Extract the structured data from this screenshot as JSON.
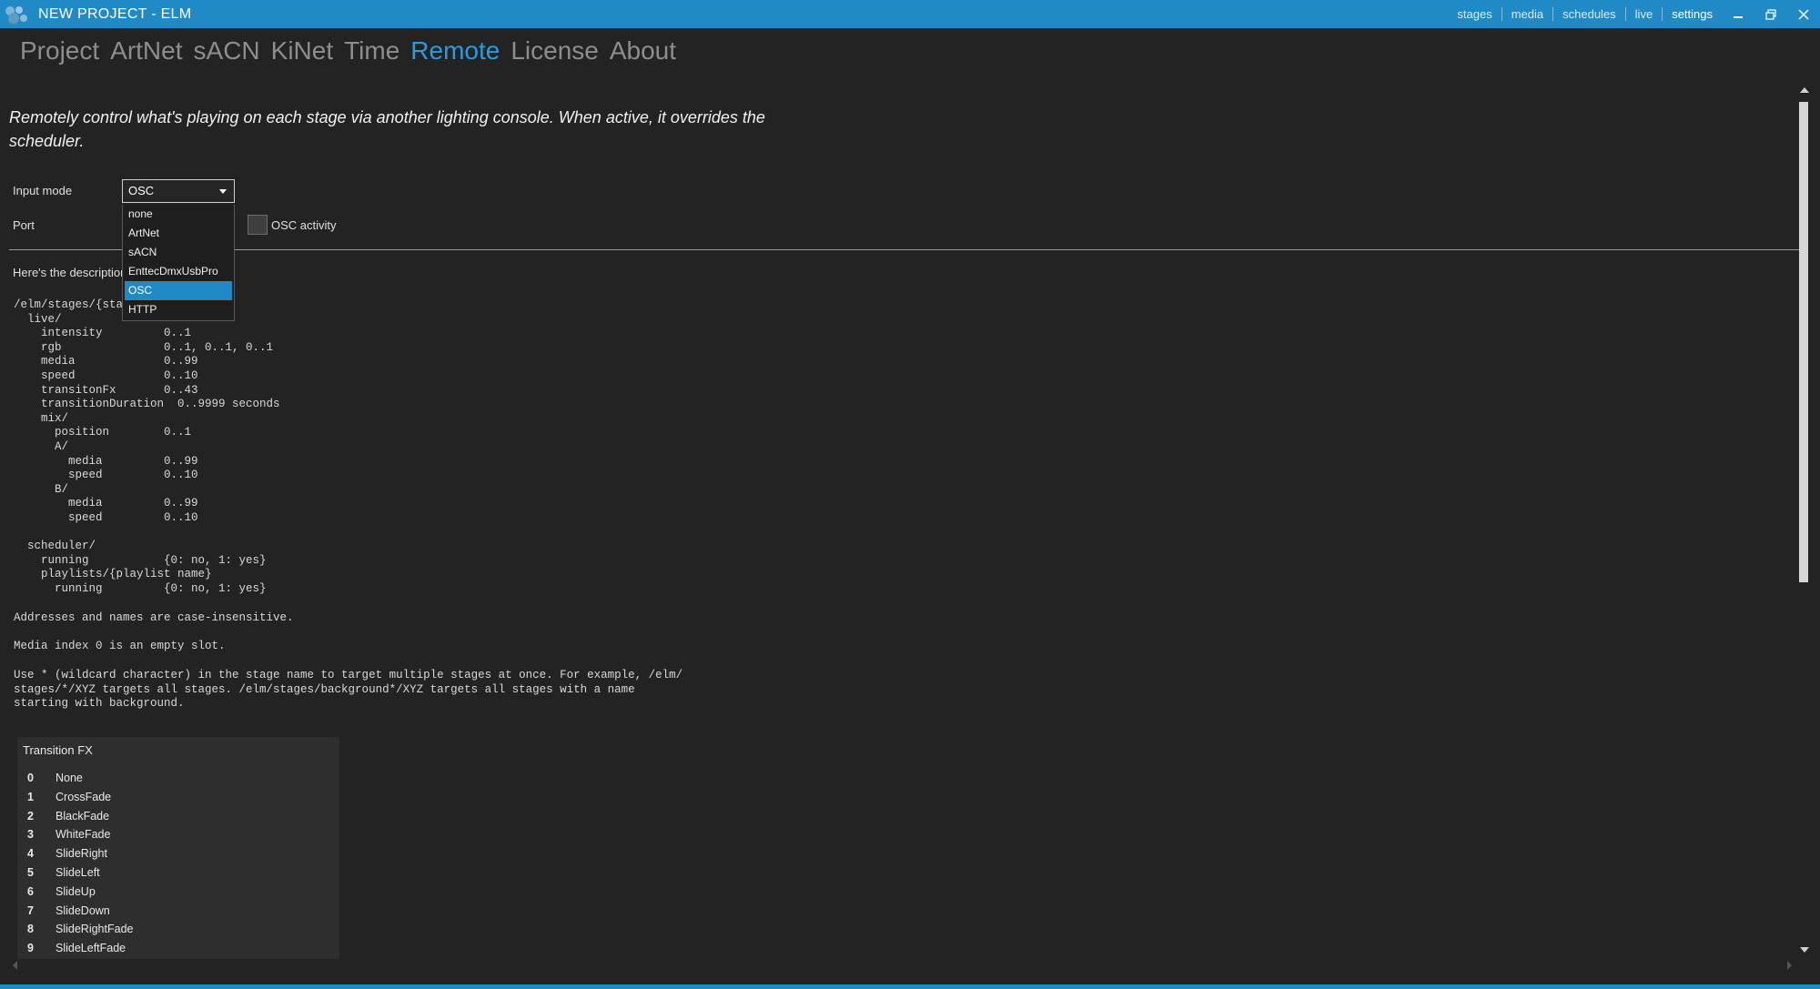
{
  "window": {
    "title": "NEW PROJECT - ELM",
    "nav": [
      "stages",
      "media",
      "schedules",
      "live",
      "settings"
    ],
    "active_nav": "settings",
    "controls": {
      "minimize": "–",
      "restore": "❐",
      "close": "✕"
    }
  },
  "tabs": [
    "Project",
    "ArtNet",
    "sACN",
    "KiNet",
    "Time",
    "Remote",
    "License",
    "About"
  ],
  "active_tab": "Remote",
  "intro": "Remotely control what's playing on each stage via another lighting console. When active, it overrides the scheduler.",
  "form": {
    "input_mode_label": "Input mode",
    "input_mode_value": "OSC",
    "port_label": "Port",
    "osc_activity_label": "OSC activity",
    "options": [
      "none",
      "ArtNet",
      "sACN",
      "EnttecDmxUsbPro",
      "OSC",
      "HTTP"
    ],
    "selected_option": "OSC"
  },
  "description_intro": "Here's the description",
  "osc_tree_lines": [
    "/elm/stages/{sta",
    "  live/",
    "    intensity         0..1",
    "    rgb               0..1, 0..1, 0..1",
    "    media             0..99",
    "    speed             0..10",
    "    transitonFx       0..43",
    "    transitionDuration  0..9999 seconds",
    "    mix/",
    "      position        0..1",
    "      A/",
    "        media         0..99",
    "        speed         0..10",
    "      B/",
    "        media         0..99",
    "        speed         0..10",
    "",
    "  scheduler/",
    "    running           {0: no, 1: yes}",
    "    playlists/{playlist name}",
    "      running         {0: no, 1: yes}"
  ],
  "notes": {
    "case": "Addresses and names are case-insensitive.",
    "media_zero": "Media index 0 is an empty slot.",
    "wildcard": "Use * (wildcard character) in the stage name to target multiple stages at once. For example, /elm/\nstages/*/XYZ targets all stages. /elm/stages/background*/XYZ targets all stages with a name\nstarting with background."
  },
  "transition_fx": {
    "title": "Transition FX",
    "rows": [
      {
        "index": "0",
        "name": "None"
      },
      {
        "index": "1",
        "name": "CrossFade"
      },
      {
        "index": "2",
        "name": "BlackFade"
      },
      {
        "index": "3",
        "name": "WhiteFade"
      },
      {
        "index": "4",
        "name": "SlideRight"
      },
      {
        "index": "5",
        "name": "SlideLeft"
      },
      {
        "index": "6",
        "name": "SlideUp"
      },
      {
        "index": "7",
        "name": "SlideDown"
      },
      {
        "index": "8",
        "name": "SlideRightFade"
      },
      {
        "index": "9",
        "name": "SlideLeftFade"
      }
    ]
  },
  "colors": {
    "titlebar": "#1f8ac6",
    "accent": "#2b9be0",
    "background": "#232323",
    "panel": "#2e2e2e"
  },
  "icons": {
    "app": "app-logo-icon",
    "dropdown": "chevron-down-icon",
    "minimize": "minimize-icon",
    "restore": "restore-icon",
    "close": "close-icon"
  }
}
